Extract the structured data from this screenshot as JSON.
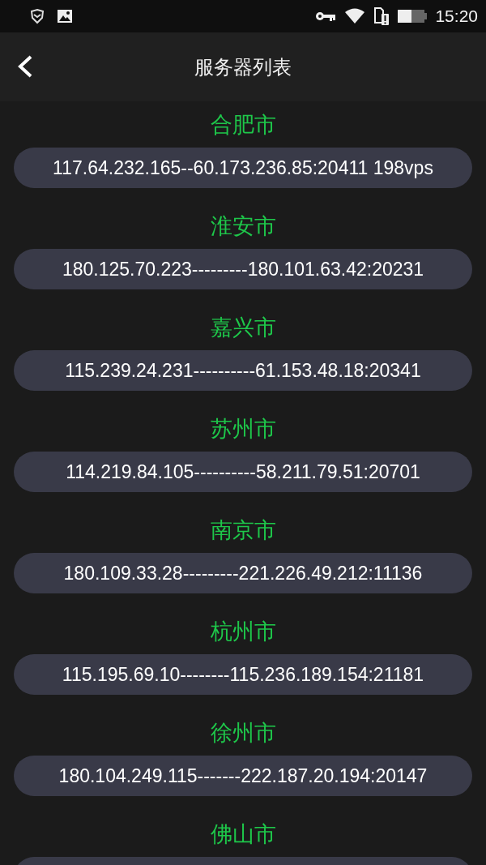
{
  "status_bar": {
    "time": "15:20"
  },
  "header": {
    "title": "服务器列表"
  },
  "servers": [
    {
      "city": "合肥市",
      "address": "117.64.232.165--60.173.236.85:20411 198vps"
    },
    {
      "city": "淮安市",
      "address": "180.125.70.223---------180.101.63.42:20231"
    },
    {
      "city": "嘉兴市",
      "address": "115.239.24.231----------61.153.48.18:20341"
    },
    {
      "city": "苏州市",
      "address": "114.219.84.105----------58.211.79.51:20701"
    },
    {
      "city": "南京市",
      "address": "180.109.33.28---------221.226.49.212:11136"
    },
    {
      "city": "杭州市",
      "address": "115.195.69.10--------115.236.189.154:21181"
    },
    {
      "city": "徐州市",
      "address": "180.104.249.115-------222.187.20.194:20147"
    },
    {
      "city": "佛山市"
    }
  ]
}
